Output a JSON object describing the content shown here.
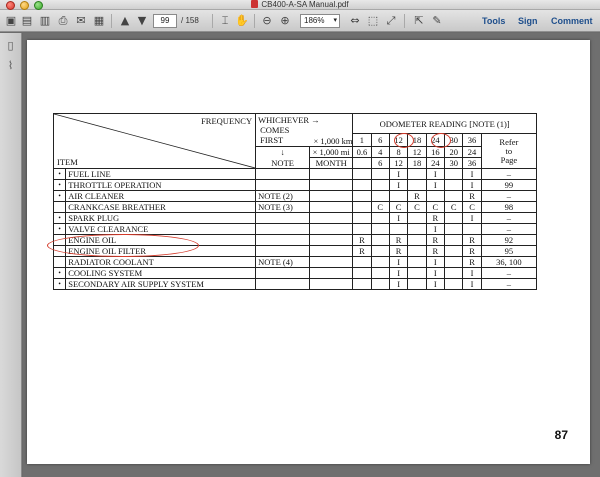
{
  "window": {
    "title": "CB400-A-SA Manual.pdf"
  },
  "toolbar": {
    "page_current": "99",
    "page_total": "/ 158",
    "zoom": "186%",
    "tools_label": "Tools",
    "sign_label": "Sign",
    "comment_label": "Comment"
  },
  "table": {
    "header": {
      "frequency": "FREQUENCY",
      "item": "ITEM",
      "whichever": "WHICHEVER →",
      "comes": "COMES",
      "first": "FIRST",
      "down_arrow": "↓",
      "note": "NOTE",
      "odometer": "ODOMETER READING [NOTE (1)]",
      "x1000km": "× 1,000 km",
      "x1000mi": "× 1,000 mi",
      "month": "MONTH",
      "km_values": [
        "1",
        "6",
        "12",
        "18",
        "24",
        "30",
        "36"
      ],
      "mi_values": [
        "0.6",
        "4",
        "8",
        "12",
        "16",
        "20",
        "24"
      ],
      "month_values": [
        "",
        "6",
        "12",
        "18",
        "24",
        "30",
        "36"
      ],
      "refer": "Refer",
      "to": "to",
      "page": "Page"
    },
    "rows": [
      {
        "dot": "•",
        "item": "FUEL LINE",
        "note": "",
        "cells": [
          "",
          "",
          "I",
          "",
          "I",
          "",
          "I"
        ],
        "ref": "–"
      },
      {
        "dot": "•",
        "item": "THROTTLE OPERATION",
        "note": "",
        "cells": [
          "",
          "",
          "I",
          "",
          "I",
          "",
          "I"
        ],
        "ref": "99"
      },
      {
        "dot": "•",
        "item": "AIR CLEANER",
        "note": "NOTE (2)",
        "cells": [
          "",
          "",
          "",
          "R",
          "",
          "",
          "R"
        ],
        "ref": "–"
      },
      {
        "dot": "",
        "item": "CRANKCASE BREATHER",
        "note": "NOTE (3)",
        "cells": [
          "",
          "C",
          "C",
          "C",
          "C",
          "C",
          "C"
        ],
        "ref": "98"
      },
      {
        "dot": "•",
        "item": "SPARK PLUG",
        "note": "",
        "cells": [
          "",
          "",
          "I",
          "",
          "R",
          "",
          "I"
        ],
        "ref": "–"
      },
      {
        "dot": "•",
        "item": "VALVE CLEARANCE",
        "note": "",
        "cells": [
          "",
          "",
          "",
          "",
          "I",
          "",
          ""
        ],
        "ref": "–"
      },
      {
        "dot": "",
        "item": "ENGINE OIL",
        "note": "",
        "cells": [
          "R",
          "",
          "R",
          "",
          "R",
          "",
          "R"
        ],
        "ref": "92"
      },
      {
        "dot": "",
        "item": "ENGINE OIL FILTER",
        "note": "",
        "cells": [
          "R",
          "",
          "R",
          "",
          "R",
          "",
          "R"
        ],
        "ref": "95"
      },
      {
        "dot": "",
        "item": "RADIATOR COOLANT",
        "note": "NOTE (4)",
        "cells": [
          "",
          "",
          "I",
          "",
          "I",
          "",
          "R"
        ],
        "ref": "36, 100"
      },
      {
        "dot": "•",
        "item": "COOLING SYSTEM",
        "note": "",
        "cells": [
          "",
          "",
          "I",
          "",
          "I",
          "",
          "I"
        ],
        "ref": "–"
      },
      {
        "dot": "•",
        "item": "SECONDARY AIR SUPPLY SYSTEM",
        "note": "",
        "cells": [
          "",
          "",
          "I",
          "",
          "I",
          "",
          "I"
        ],
        "ref": "–"
      }
    ]
  },
  "page_number": "87",
  "colors": {
    "annotation": "#d43a2a",
    "link": "#1f4f8c"
  }
}
